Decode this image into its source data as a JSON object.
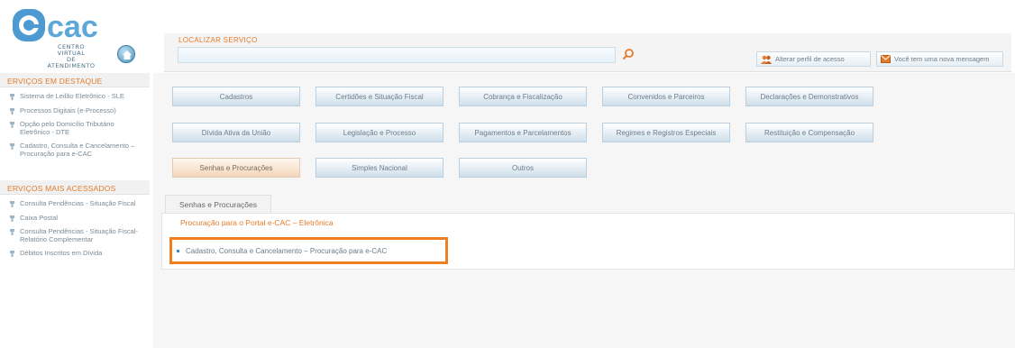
{
  "logo": {
    "brand": "ecac",
    "subtitle_line1": "CENTRO VIRTUAL",
    "subtitle_line2": "DE ATENDIMENTO"
  },
  "search": {
    "label": "LOCALIZAR SERVIÇO",
    "value": "",
    "placeholder": ""
  },
  "header_buttons": {
    "profile": "Alterar perfil de acesso",
    "message": "Você tem uma nova mensagem"
  },
  "sidebar": {
    "highlight_title": "ERVIÇOS EM DESTAQUE",
    "highlight_items": [
      "Sistema de Leilão Eletrônico - SLE",
      "Processos Digitais (e-Processo)",
      "Opção pelo Domicílio Tributário Eletrônico - DTE",
      "Cadastro, Consulta e Cancelamento – Procuração para e-CAC"
    ],
    "popular_title": "ERVIÇOS MAIS ACESSADOS",
    "popular_items": [
      "Consulta Pendências - Situação Fiscal",
      "Caixa Postal",
      "Consulta Pendências - Situação Fiscal-Relatório Complementar",
      "Débitos Inscritos em Dívida"
    ]
  },
  "categories": {
    "row1": [
      "Cadastros",
      "Certidões e Situação Fiscal",
      "Cobrança e Fiscalização",
      "Convenidos e Parceiros",
      "Declarações e Demonstrativos"
    ],
    "row2": [
      "Dívida Ativa da União",
      "Legislação e Processo",
      "Pagamentos e Parcelamentos",
      "Regimes e Registros Especiais",
      "Restituição e Compensação"
    ],
    "row3": [
      "Senhas e Procurações",
      "Simples Nacional",
      "Outros"
    ]
  },
  "tab": {
    "label": "Senhas e Procurações",
    "section_title": "Procuração para o Portal e-CAC – Eletrônica",
    "link": "Cadastro, Consulta e Cancelamento – Procuração para e-CAC"
  },
  "colors": {
    "accent": "#e47b2a",
    "highlight_box": "#ef7e21",
    "button_border": "#b9cfdf"
  }
}
